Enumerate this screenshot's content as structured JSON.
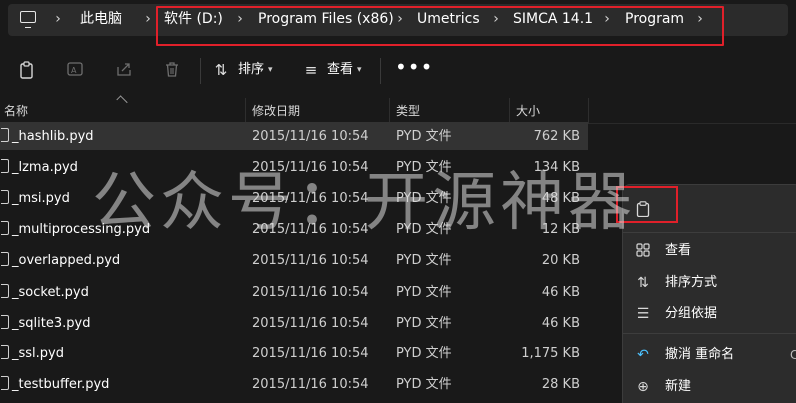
{
  "address_bar": {
    "crumbs": [
      "此电脑",
      "软件 (D:)",
      "Program Files (x86)",
      "Umetrics",
      "SIMCA 14.1",
      "Program"
    ]
  },
  "toolbar": {
    "sort_label": "排序",
    "view_label": "查看",
    "more_label": "•••"
  },
  "columns": {
    "name": "名称",
    "date": "修改日期",
    "type": "类型",
    "size": "大小"
  },
  "files": [
    {
      "name": "_hashlib.pyd",
      "date": "2015/11/16 10:54",
      "type": "PYD 文件",
      "size": "762 KB"
    },
    {
      "name": "_lzma.pyd",
      "date": "2015/11/16 10:54",
      "type": "PYD 文件",
      "size": "134 KB"
    },
    {
      "name": "_msi.pyd",
      "date": "2015/11/16 10:54",
      "type": "PYD 文件",
      "size": "48 KB"
    },
    {
      "name": "_multiprocessing.pyd",
      "date": "2015/11/16 10:54",
      "type": "PYD 文件",
      "size": "12 KB"
    },
    {
      "name": "_overlapped.pyd",
      "date": "2015/11/16 10:54",
      "type": "PYD 文件",
      "size": "20 KB"
    },
    {
      "name": "_socket.pyd",
      "date": "2015/11/16 10:54",
      "type": "PYD 文件",
      "size": "46 KB"
    },
    {
      "name": "_sqlite3.pyd",
      "date": "2015/11/16 10:54",
      "type": "PYD 文件",
      "size": "46 KB"
    },
    {
      "name": "_ssl.pyd",
      "date": "2015/11/16 10:54",
      "type": "PYD 文件",
      "size": "1,175 KB"
    },
    {
      "name": "_testbuffer.pyd",
      "date": "2015/11/16 10:54",
      "type": "PYD 文件",
      "size": "28 KB"
    }
  ],
  "watermark": "公众号：开源神器",
  "context_menu": {
    "view": "查看",
    "sort_by": "排序方式",
    "group_by": "分组依据",
    "undo": "撤消 重命名",
    "undo_accel": "C",
    "new": "新建"
  },
  "colors": {
    "background": "#191919",
    "selected_row": "#333333",
    "highlight_box": "#e0202a",
    "accent_icon": "#4cc2ff"
  }
}
